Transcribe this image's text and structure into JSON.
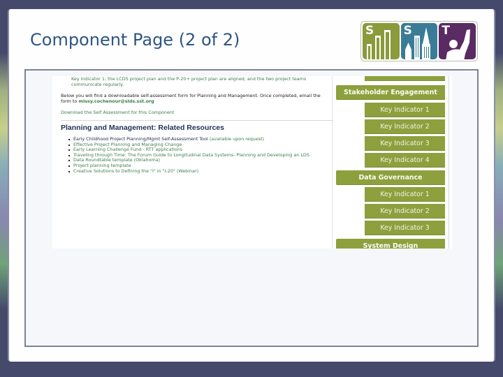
{
  "slide": {
    "title": "Component Page (2 of 2)",
    "logo": {
      "tiles": [
        {
          "letter": "S",
          "color": "#8b9a3a",
          "icon": "bar-chart-icon"
        },
        {
          "letter": "S",
          "color": "#3a7c97",
          "icon": "city-skyline-icon"
        },
        {
          "letter": "T",
          "color": "#5a2a63",
          "icon": "raised-fist-person-icon"
        }
      ]
    }
  },
  "screenshot": {
    "intro": {
      "indicator_text": "Key Indicator 1: the LCDS project plan and the P-20+ project plan are aligned, and the two project teams communicate regularly.",
      "download_intro": "Below you will find a downloadable self-assessment form for Planning and Management. Once completed, email the form to",
      "email": "missy.cochenour@slds.sst.org",
      "download_link": "Download the Self Assessment for this Component"
    },
    "resources": {
      "heading": "Planning and Management: Related Resources",
      "items": [
        {
          "text": "Early Childhood Project Planning/Mgmt Self-Assessment Tool",
          "note": "(available upon request)"
        },
        {
          "text": "Effective Project Planning and Managing Change",
          "note": ""
        },
        {
          "text": "Early Learning Challenge Fund - RTT applications",
          "note": ""
        },
        {
          "text": "Traveling through Time: The Forum Guide to Longitudinal Data Systems- Planning and Developing an LDS",
          "note": ""
        },
        {
          "text": "Data Roundtable template (Oklahoma)",
          "note": ""
        },
        {
          "text": "Project planning template",
          "note": ""
        },
        {
          "text": "Creative Solutions to Defining the \"I\" in \"I-20\" (Webinar)",
          "note": ""
        }
      ]
    },
    "nav": {
      "items": [
        {
          "label": "",
          "type": "sub"
        },
        {
          "label": "Stakeholder Engagement",
          "type": "section"
        },
        {
          "label": "Key Indicator 1",
          "type": "sub"
        },
        {
          "label": "Key Indicator 2",
          "type": "sub"
        },
        {
          "label": "Key Indicator 3",
          "type": "sub"
        },
        {
          "label": "Key Indicator 4",
          "type": "sub"
        },
        {
          "label": "Data Governance",
          "type": "section"
        },
        {
          "label": "Key Indicator 1",
          "type": "sub"
        },
        {
          "label": "Key Indicator 2",
          "type": "sub"
        },
        {
          "label": "Key Indicator 3",
          "type": "sub"
        },
        {
          "label": "System Design",
          "type": "section"
        }
      ]
    }
  }
}
